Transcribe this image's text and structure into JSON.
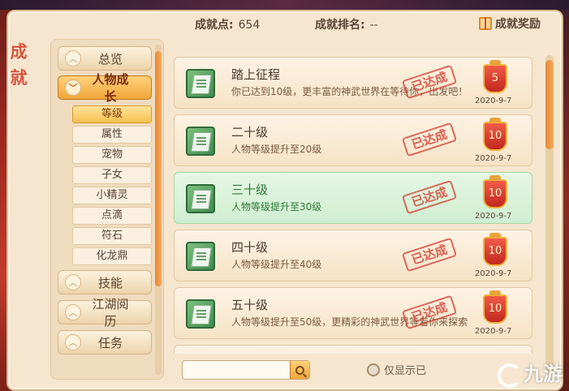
{
  "side_title": "成就",
  "header": {
    "points_label": "成就点:",
    "points_value": "654",
    "rank_label": "成就排名:",
    "rank_value": "--",
    "reward_label": "成就奖励"
  },
  "nav": {
    "main": [
      {
        "label": "总览",
        "active": false
      },
      {
        "label": "人物成长",
        "active": true
      },
      {
        "label": "技能",
        "active": false
      },
      {
        "label": "江湖阅历",
        "active": false
      },
      {
        "label": "任务",
        "active": false
      }
    ],
    "sub": [
      {
        "label": "等级",
        "active": true
      },
      {
        "label": "属性",
        "active": false
      },
      {
        "label": "宠物",
        "active": false
      },
      {
        "label": "子女",
        "active": false
      },
      {
        "label": "小精灵",
        "active": false
      },
      {
        "label": "点滴",
        "active": false
      },
      {
        "label": "符石",
        "active": false
      },
      {
        "label": "化龙鼎",
        "active": false
      }
    ]
  },
  "achievements": [
    {
      "title": "踏上征程",
      "desc": "你已达到10级，更丰富的神武世界在等待你，出发吧！",
      "stamp": "已达成",
      "points": "5",
      "date": "2020-9-7",
      "highlight": false
    },
    {
      "title": "二十级",
      "desc": "人物等级提升至20级",
      "stamp": "已达成",
      "points": "10",
      "date": "2020-9-7",
      "highlight": false
    },
    {
      "title": "三十级",
      "desc": "人物等级提升至30级",
      "stamp": "已达成",
      "points": "10",
      "date": "2020-9-7",
      "highlight": true
    },
    {
      "title": "四十级",
      "desc": "人物等级提升至40级",
      "stamp": "已达成",
      "points": "10",
      "date": "2020-9-7",
      "highlight": false
    },
    {
      "title": "五十级",
      "desc": "人物等级提升至50级，更精彩的神武世界等着你来探索",
      "stamp": "已达成",
      "points": "10",
      "date": "2020-9-7",
      "highlight": false
    }
  ],
  "search": {
    "placeholder": ""
  },
  "filter": {
    "label": "仅显示已"
  },
  "watermark": "九游"
}
